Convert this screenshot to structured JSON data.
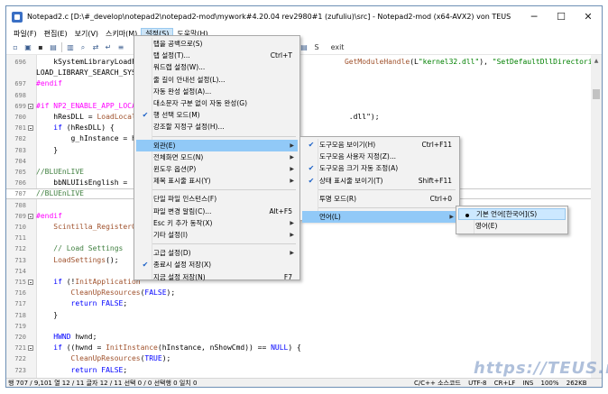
{
  "window": {
    "title": "Notepad2.c [D:\\#_develop\\notepad2\\notepad2-mod\\mywork#4.20.04 rev2980#1 (zufuliu)\\src] - Notepad2-mod (x64-AVX2) von TEUS",
    "buttons": {
      "minimize": "─",
      "maximize": "☐",
      "close": "✕"
    }
  },
  "menubar": {
    "items": [
      {
        "label": "파일(F)"
      },
      {
        "label": "편집(E)"
      },
      {
        "label": "보기(V)"
      },
      {
        "label": "스키마(M)"
      },
      {
        "label": "설정(S)",
        "active": true
      },
      {
        "label": "도움말(H)"
      }
    ]
  },
  "toolbar": {
    "icons": [
      "new-icon",
      "open-icon",
      "save-icon",
      "save-as-icon",
      "print-icon",
      "find-icon",
      "replace-icon",
      "wordwrap-icon",
      "schema-icon",
      "exit-icon"
    ],
    "trailing_label": "S",
    "exit_label": "exit"
  },
  "editor": {
    "lines": [
      {
        "n": "696",
        "segs": [
          [
            "",
            "    kSystemLibraryLoadFl"
          ],
          [
            "c-fn",
            "                                               GetModuleHandle"
          ],
          [
            "",
            "(L"
          ],
          [
            "c-st",
            "\"kernel32.dll\""
          ],
          [
            "",
            "), "
          ],
          [
            "c-st",
            "\"SetDefaultDllDirectories\""
          ],
          [
            "",
            ")) ?"
          ]
        ]
      },
      {
        "n": "",
        "segs": [
          [
            "",
            "LOAD_LIBRARY_SEARCH_SYST"
          ]
        ]
      },
      {
        "n": "697",
        "segs": [
          [
            "c-pp",
            "#endif"
          ]
        ]
      },
      {
        "n": "698",
        "segs": []
      },
      {
        "n": "699",
        "fold": true,
        "segs": [
          [
            "c-pp",
            "#if NP2_ENABLE_APP_LOCAL"
          ]
        ]
      },
      {
        "n": "700",
        "segs": [
          [
            "",
            "    hResDLL = "
          ],
          [
            "c-fn",
            "LoadLocali"
          ],
          [
            "",
            "                                                .dll\");"
          ]
        ]
      },
      {
        "n": "701",
        "fold": true,
        "segs": [
          [
            "c-kw",
            "    if"
          ],
          [
            "",
            " (hResDLL) {"
          ]
        ]
      },
      {
        "n": "702",
        "segs": [
          [
            "",
            "        g_hInstance = hI"
          ]
        ]
      },
      {
        "n": "703",
        "segs": [
          [
            "",
            "    }"
          ]
        ]
      },
      {
        "n": "704",
        "segs": []
      },
      {
        "n": "705",
        "segs": [
          [
            "c-cm",
            "//BLUEnLIVE"
          ]
        ]
      },
      {
        "n": "706",
        "segs": [
          [
            "",
            "    bbNLUIisEnglish = !!"
          ]
        ]
      },
      {
        "n": "707",
        "current": true,
        "segs": [
          [
            "c-cm",
            "//BLUEnLIVE"
          ]
        ]
      },
      {
        "n": "708",
        "segs": []
      },
      {
        "n": "709",
        "fold": true,
        "segs": [
          [
            "c-pp",
            "#endif"
          ]
        ]
      },
      {
        "n": "710",
        "segs": [
          [
            "",
            "    "
          ],
          [
            "c-fn",
            "Scintilla_RegisterCl"
          ]
        ]
      },
      {
        "n": "711",
        "segs": []
      },
      {
        "n": "712",
        "segs": [
          [
            "c-cm",
            "    // Load Settings"
          ]
        ]
      },
      {
        "n": "713",
        "segs": [
          [
            "",
            "    "
          ],
          [
            "c-fn",
            "LoadSettings"
          ],
          [
            "",
            "();"
          ]
        ]
      },
      {
        "n": "714",
        "segs": []
      },
      {
        "n": "715",
        "fold": true,
        "segs": [
          [
            "c-kw",
            "    if"
          ],
          [
            "",
            " (!"
          ],
          [
            "c-fn",
            "InitApplication"
          ]
        ]
      },
      {
        "n": "716",
        "segs": [
          [
            "",
            "        "
          ],
          [
            "c-fn",
            "CleanUpResources"
          ],
          [
            "",
            "("
          ],
          [
            "c-kw",
            "FALSE"
          ],
          [
            "",
            ");"
          ]
        ]
      },
      {
        "n": "717",
        "segs": [
          [
            "c-kw",
            "        return"
          ],
          [
            "",
            " "
          ],
          [
            "c-kw",
            "FALSE"
          ],
          [
            "",
            ";"
          ]
        ]
      },
      {
        "n": "718",
        "segs": [
          [
            "",
            "    }"
          ]
        ]
      },
      {
        "n": "719",
        "segs": []
      },
      {
        "n": "720",
        "segs": [
          [
            "c-ty",
            "    HWND"
          ],
          [
            "",
            " hwnd;"
          ]
        ]
      },
      {
        "n": "721",
        "fold": true,
        "segs": [
          [
            "c-kw",
            "    if"
          ],
          [
            "",
            " ((hwnd = "
          ],
          [
            "c-fn",
            "InitInstance"
          ],
          [
            "",
            "(hInstance, nShowCmd)) == "
          ],
          [
            "c-kw",
            "NULL"
          ],
          [
            "",
            ") {"
          ]
        ]
      },
      {
        "n": "722",
        "segs": [
          [
            "",
            "        "
          ],
          [
            "c-fn",
            "CleanUpResources"
          ],
          [
            "",
            "("
          ],
          [
            "c-kw",
            "TRUE"
          ],
          [
            "",
            ");"
          ]
        ]
      },
      {
        "n": "723",
        "segs": [
          [
            "c-kw",
            "        return"
          ],
          [
            "",
            " "
          ],
          [
            "c-kw",
            "FALSE"
          ],
          [
            "",
            ";"
          ]
        ]
      },
      {
        "n": "724",
        "segs": [
          [
            "",
            "    }"
          ]
        ]
      }
    ]
  },
  "statusbar": {
    "left": "행 707 / 9,101  열 12 / 11  글자 12 / 11  선택 0 / 0  선택행 0  일치 0",
    "encoding": "C/C++ 소스코드",
    "charset": "UTF-8",
    "eol": "CR+LF",
    "mode": "INS",
    "zoom": "100%",
    "size": "262KB"
  },
  "settings_menu": {
    "items": [
      {
        "label": "탭을 공백으로(S)"
      },
      {
        "label": "탭 설정(T)...",
        "shortcut": "Ctrl+T"
      },
      {
        "label": "워드랩 설정(W)..."
      },
      {
        "label": "줄 길이 안내선 설정(L)..."
      },
      {
        "label": "자동 완성 설정(A)..."
      },
      {
        "label": "대소문자 구분 없이 자동 완성(G)"
      },
      {
        "label": "행 선택 모드(M)",
        "checked": true
      },
      {
        "label": "강조할 지정구 설정(H)..."
      },
      {
        "sep": true
      },
      {
        "label": "외관(E)",
        "submenu": true,
        "highlight": true
      },
      {
        "label": "전체화면 모드(N)",
        "submenu": true
      },
      {
        "label": "윈도우 옵션(P)",
        "submenu": true
      },
      {
        "label": "제목 표시줄 표시(Y)",
        "submenu": true
      },
      {
        "sep": true
      },
      {
        "label": "단일 파일 인스턴스(F)"
      },
      {
        "label": "파일 변경 알림(C)...",
        "shortcut": "Alt+F5"
      },
      {
        "label": "Esc 키 추가 동작(X)",
        "submenu": true
      },
      {
        "label": "기타 설정(I)",
        "submenu": true
      },
      {
        "sep": true
      },
      {
        "label": "고급 설정(D)",
        "submenu": true
      },
      {
        "label": "종료시 설정 저장(X)",
        "checked": true
      },
      {
        "label": "지금 설정 저장(N)",
        "shortcut": "F7"
      }
    ]
  },
  "appearance_menu": {
    "items": [
      {
        "label": "도구모음 보이기(H)",
        "shortcut": "Ctrl+F11",
        "checked": true
      },
      {
        "label": "도구모음 사용자 지정(Z)..."
      },
      {
        "label": "도구모음 크기 자동 조정(A)",
        "checked": true
      },
      {
        "label": "상태 표시줄 보이기(T)",
        "shortcut": "Shift+F11",
        "checked": true
      },
      {
        "sep": true
      },
      {
        "label": "투명 모드(R)",
        "shortcut": "Ctrl+0"
      },
      {
        "sep": true
      },
      {
        "label": "언어(L)",
        "submenu": true,
        "highlight": true
      }
    ]
  },
  "language_menu": {
    "items": [
      {
        "label": "기본 언어[한국어](S)",
        "radio": true,
        "highlight": true
      },
      {
        "label": "영어(E)"
      }
    ]
  },
  "watermark": "https://TEUS.me"
}
